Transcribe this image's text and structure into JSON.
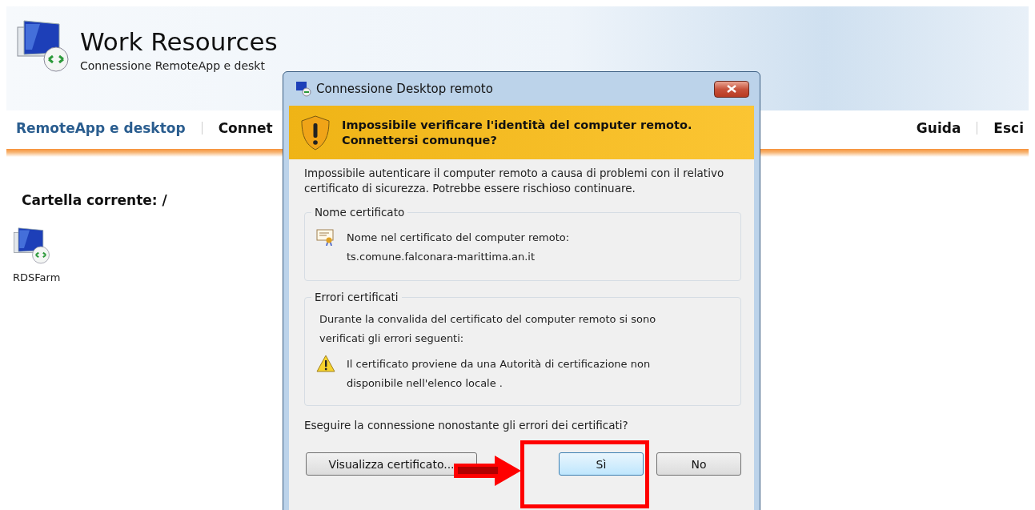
{
  "header": {
    "title": "Work Resources",
    "subtitle": "Connessione RemoteApp e deskt"
  },
  "nav": {
    "left": [
      {
        "label": "RemoteApp e desktop",
        "selected": true
      },
      {
        "label": "Connet",
        "selected": false
      }
    ],
    "right": [
      {
        "label": "Guida"
      },
      {
        "label": "Esci"
      }
    ]
  },
  "folder": {
    "label": "Cartella corrente: /"
  },
  "resources": [
    {
      "label": "RDSFarm"
    }
  ],
  "dialog": {
    "title": "Connessione Desktop remoto",
    "banner": "Impossibile verificare l'identità del computer remoto. Connettersi comunque?",
    "message": "Impossibile autenticare il computer remoto a causa di problemi con il relativo certificato di sicurezza. Potrebbe essere rischioso continuare.",
    "groups": [
      {
        "kind": "name",
        "title": "Nome certificato",
        "lines": [
          "Nome nel certificato del computer remoto:",
          "ts.comune.falconara-marittima.an.it"
        ]
      },
      {
        "kind": "errors",
        "title": "Errori certificati",
        "intro": "Durante la convalida del certificato del computer remoto si sono verificati gli errori seguenti:",
        "lines": [
          "Il certificato proviene da una Autorità di certificazione non disponibile nell'elenco locale ."
        ]
      }
    ],
    "question": "Eseguire la connessione nonostante gli errori dei certificati?",
    "buttons": [
      {
        "label": "Visualizza certificato...",
        "kind": "left",
        "highlighted": false
      },
      {
        "label": "Sì",
        "kind": "right",
        "highlighted": true
      },
      {
        "label": "No",
        "kind": "right",
        "highlighted": false
      }
    ]
  }
}
